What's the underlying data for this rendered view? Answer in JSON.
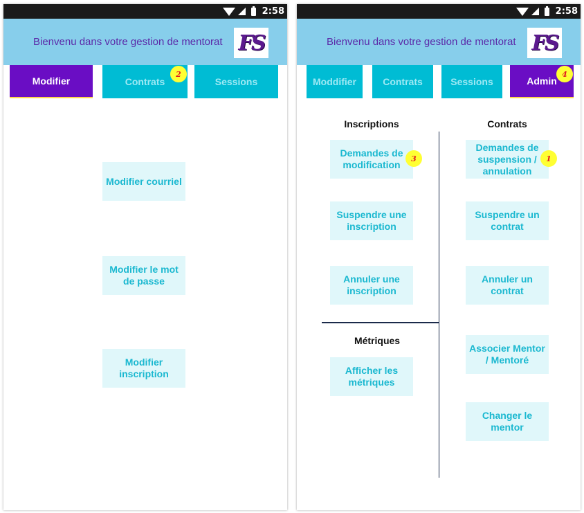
{
  "status_bar": {
    "time": "2:58"
  },
  "app": {
    "welcome": "Bienvenu dans votre gestion de mentorat",
    "logo_text": "FS"
  },
  "left_screen": {
    "tabs": [
      "Modifier",
      "Contrats",
      "Sessions"
    ],
    "active_tab": "Modifier",
    "badge": "2",
    "buttons": [
      "Modifier courriel",
      "Modifier le mot de passe",
      "Modifier inscription"
    ]
  },
  "right_screen": {
    "tabs": [
      "Moddifier",
      "Contrats",
      "Sessions",
      "Admin"
    ],
    "active_tab": "Admin",
    "badges": {
      "admin": "4",
      "modification": "3",
      "suspension": "1"
    },
    "inscriptions": {
      "heading": "Inscriptions",
      "buttons": [
        "Demandes de modification",
        "Suspendre une inscription",
        "Annuler une inscription"
      ]
    },
    "metriques": {
      "heading": "Métriques",
      "buttons": [
        "Afficher les métriques"
      ]
    },
    "contrats": {
      "heading": "Contrats",
      "buttons": [
        "Demandes de suspension / annulation",
        "Suspendre un contrat",
        "Annuler un contrat",
        "Associer Mentor / Mentoré",
        "Changer le mentor"
      ]
    }
  },
  "colors": {
    "status_bar": "#1a1a1a",
    "app_bar": "#87ceeb",
    "tab": "#00bcd4",
    "tab_active": "#6a0dc4",
    "button_bg": "#e0f7fa",
    "button_text": "#1ab8d0",
    "badge": "#ffff33",
    "divider": "#1b2a4a"
  }
}
